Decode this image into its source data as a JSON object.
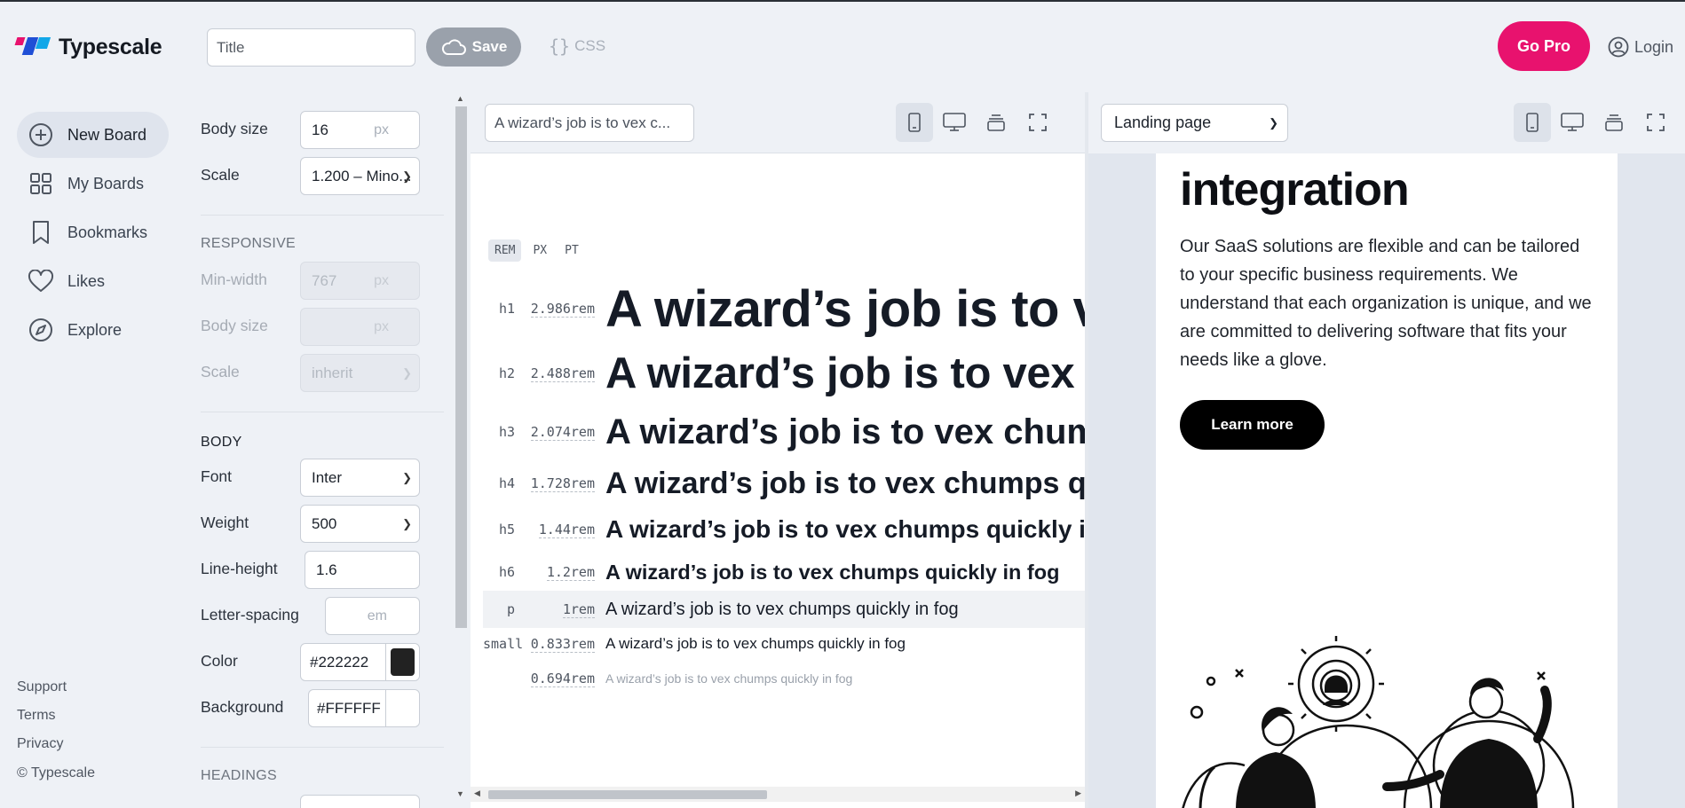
{
  "app": {
    "name": "Typescale",
    "colors": {
      "brand_pink": "#e8126e",
      "brand_blue": "#1f4fd6",
      "brand_cyan": "#12a7e8"
    }
  },
  "header": {
    "title_placeholder": "Title",
    "save_label": "Save",
    "css_label": "CSS",
    "gopro_label": "Go Pro",
    "login_label": "Login"
  },
  "nav": {
    "items": [
      {
        "label": "New Board",
        "icon": "plus-circle-icon",
        "active": true
      },
      {
        "label": "My Boards",
        "icon": "grid-icon"
      },
      {
        "label": "Bookmarks",
        "icon": "bookmark-icon"
      },
      {
        "label": "Likes",
        "icon": "heart-icon"
      },
      {
        "label": "Explore",
        "icon": "compass-icon"
      }
    ],
    "footer": [
      "Support",
      "Terms",
      "Privacy",
      "© Typescale"
    ]
  },
  "settings": {
    "body_size_label": "Body size",
    "body_size_value": "16",
    "unit_px": "px",
    "scale_label": "Scale",
    "scale_value": "1.200 – Mino...",
    "responsive_heading": "RESPONSIVE",
    "min_width_label": "Min-width",
    "min_width_value": "767",
    "resp_body_size_label": "Body size",
    "resp_scale_label": "Scale",
    "resp_scale_value": "inherit",
    "body_heading": "BODY",
    "font_label": "Font",
    "font_value": "Inter",
    "weight_label": "Weight",
    "weight_value": "500",
    "line_height_label": "Line-height",
    "line_height_value": "1.6",
    "letter_spacing_label": "Letter-spacing",
    "unit_em": "em",
    "color_label": "Color",
    "color_value": "#222222",
    "background_label": "Background",
    "background_value": "#FFFFFF",
    "headings_heading": "HEADINGS"
  },
  "preview": {
    "text_value": "A wizard’s job is to vex c...",
    "unit_tabs": [
      "REM",
      "PX",
      "PT"
    ],
    "sample": "A wizard’s job is to vex chumps quickly in fog",
    "rows": [
      {
        "tag": "h1",
        "value": "2.986rem"
      },
      {
        "tag": "h2",
        "value": "2.488rem"
      },
      {
        "tag": "h3",
        "value": "2.074rem"
      },
      {
        "tag": "h4",
        "value": "1.728rem"
      },
      {
        "tag": "h5",
        "value": "1.44rem"
      },
      {
        "tag": "h6",
        "value": "1.2rem"
      },
      {
        "tag": "p",
        "value": "1rem"
      },
      {
        "tag": "small",
        "value": "0.833rem"
      },
      {
        "tag": "",
        "value": "0.694rem"
      }
    ]
  },
  "landing": {
    "template_select": "Landing page",
    "heading": "integration",
    "paragraph": "Our SaaS solutions are flexible and can be tailored to your specific business requirements. We understand that each organization is unique, and we are committed to delivering software that fits your needs like a glove.",
    "cta": "Learn more"
  }
}
